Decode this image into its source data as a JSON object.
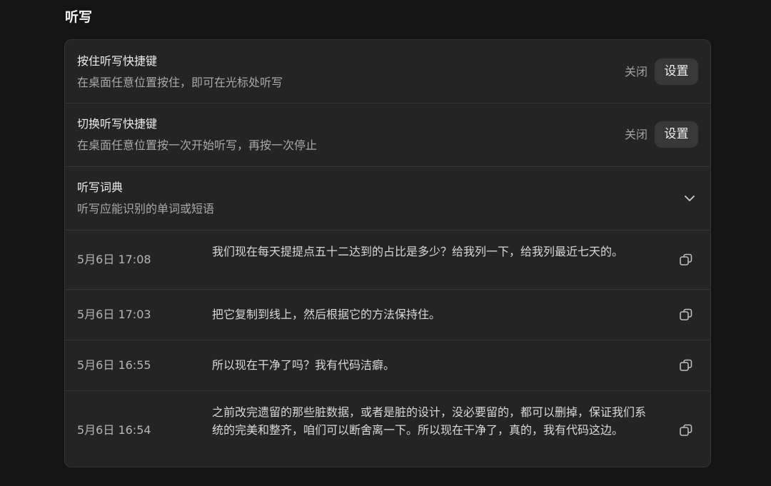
{
  "section": {
    "title": "听写"
  },
  "settings": [
    {
      "title": "按住听写快捷键",
      "description": "在桌面任意位置按住，即可在光标处听写",
      "status": "关闭",
      "button_label": "设置"
    },
    {
      "title": "切换听写快捷键",
      "description": "在桌面任意位置按一次开始听写，再按一次停止",
      "status": "关闭",
      "button_label": "设置"
    }
  ],
  "dictionary": {
    "title": "听写词典",
    "description": "听写应能识别的单词或短语",
    "expand_icon": "chevron-down-icon"
  },
  "history": [
    {
      "time": "5月6日 17:08",
      "text": "我们现在每天提提点五十二达到的占比是多少？给我列一下，给我列最近七天的。",
      "action_icon": "copy-icon"
    },
    {
      "time": "5月6日 17:03",
      "text": "把它复制到线上，然后根据它的方法保持住。",
      "action_icon": "copy-icon"
    },
    {
      "time": "5月6日 16:55",
      "text": "所以现在干净了吗？我有代码洁癖。",
      "action_icon": "copy-icon"
    },
    {
      "time": "5月6日 16:54",
      "text": "之前改完遗留的那些脏数据，或者是脏的设计，没必要留的，都可以删掉，保证我们系统的完美和整齐，咱们可以断舍离一下。所以现在干净了，真的，我有代码这边。",
      "action_icon": "copy-icon"
    }
  ],
  "colors": {
    "background": "#141414",
    "card": "#242424",
    "divider": "#343434",
    "button": "#383838"
  }
}
